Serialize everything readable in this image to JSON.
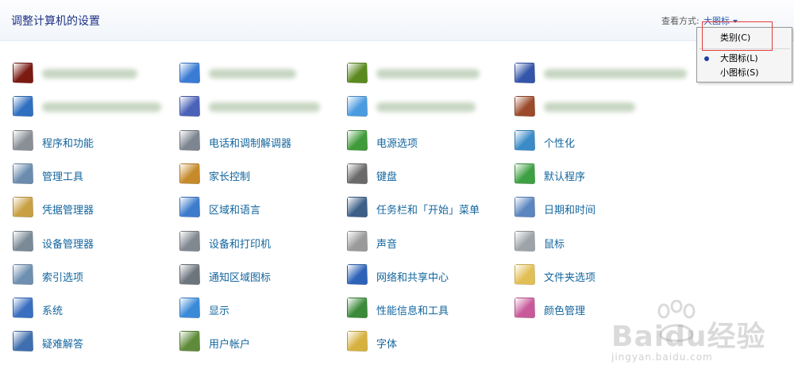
{
  "header": {
    "title": "调整计算机的设置",
    "view_label": "查看方式:",
    "view_value": "大图标"
  },
  "view_menu": {
    "items": [
      {
        "label": "类别(C)",
        "selected": false
      },
      {
        "label": "大图标(L)",
        "selected": true
      },
      {
        "label": "小图标(S)",
        "selected": false
      }
    ]
  },
  "items": [
    {
      "label": "",
      "icon": "flash-player-icon",
      "color": "#7a1a10"
    },
    {
      "label": "",
      "icon": "internet-options-icon",
      "color": "#3a7bd5"
    },
    {
      "label": "",
      "icon": "nvidia-control-panel-icon",
      "color": "#5a8a1e"
    },
    {
      "label": "",
      "icon": "realtek-audio-icon",
      "color": "#3355aa"
    },
    {
      "label": "",
      "icon": "remote-app-icon",
      "color": "#2f6fc0"
    },
    {
      "label": "",
      "icon": "windows-cardspace-icon",
      "color": "#4a62b8"
    },
    {
      "label": "",
      "icon": "windows-update-icon",
      "color": "#4a9be0"
    },
    {
      "label": "",
      "icon": "windows-firewall-icon",
      "color": "#9b4a2a"
    },
    {
      "label": "程序和功能",
      "icon": "programs-features-icon",
      "color": "#8a8f96"
    },
    {
      "label": "电话和调制解调器",
      "icon": "phone-modem-icon",
      "color": "#7d8690"
    },
    {
      "label": "电源选项",
      "icon": "power-options-icon",
      "color": "#3f9a3a"
    },
    {
      "label": "个性化",
      "icon": "personalization-icon",
      "color": "#3a8bc8"
    },
    {
      "label": "管理工具",
      "icon": "admin-tools-icon",
      "color": "#6b8cae"
    },
    {
      "label": "家长控制",
      "icon": "parental-controls-icon",
      "color": "#c58a2a"
    },
    {
      "label": "键盘",
      "icon": "keyboard-icon",
      "color": "#6a6a6a"
    },
    {
      "label": "默认程序",
      "icon": "default-programs-icon",
      "color": "#3da042"
    },
    {
      "label": "凭据管理器",
      "icon": "credential-manager-icon",
      "color": "#c8a043"
    },
    {
      "label": "区域和语言",
      "icon": "region-language-icon",
      "color": "#3e7ccb"
    },
    {
      "label": "任务栏和「开始」菜单",
      "icon": "taskbar-start-icon",
      "color": "#3c5f88"
    },
    {
      "label": "日期和时间",
      "icon": "date-time-icon",
      "color": "#5b86c0"
    },
    {
      "label": "设备管理器",
      "icon": "device-manager-icon",
      "color": "#7b8a97"
    },
    {
      "label": "设备和打印机",
      "icon": "devices-printers-icon",
      "color": "#808890"
    },
    {
      "label": "声音",
      "icon": "sound-icon",
      "color": "#9a9a9a"
    },
    {
      "label": "鼠标",
      "icon": "mouse-icon",
      "color": "#9da3a8"
    },
    {
      "label": "索引选项",
      "icon": "indexing-options-icon",
      "color": "#6e8fb0"
    },
    {
      "label": "通知区域图标",
      "icon": "notification-area-icon",
      "color": "#6c747c"
    },
    {
      "label": "网络和共享中心",
      "icon": "network-sharing-icon",
      "color": "#2c62b8"
    },
    {
      "label": "文件夹选项",
      "icon": "folder-options-icon",
      "color": "#e2bf55"
    },
    {
      "label": "系统",
      "icon": "system-icon",
      "color": "#3a6ec0"
    },
    {
      "label": "显示",
      "icon": "display-icon",
      "color": "#3a8ad8"
    },
    {
      "label": "性能信息和工具",
      "icon": "performance-tools-icon",
      "color": "#3a8a3a"
    },
    {
      "label": "颜色管理",
      "icon": "color-management-icon",
      "color": "#c85a9a"
    },
    {
      "label": "疑难解答",
      "icon": "troubleshooting-icon",
      "color": "#3f6fae"
    },
    {
      "label": "用户帐户",
      "icon": "user-accounts-icon",
      "color": "#5f8a3a"
    },
    {
      "label": "字体",
      "icon": "fonts-icon",
      "color": "#d6b13e"
    }
  ],
  "watermark": {
    "brand": "Baidu经验",
    "url": "jingyan.baidu.com"
  }
}
